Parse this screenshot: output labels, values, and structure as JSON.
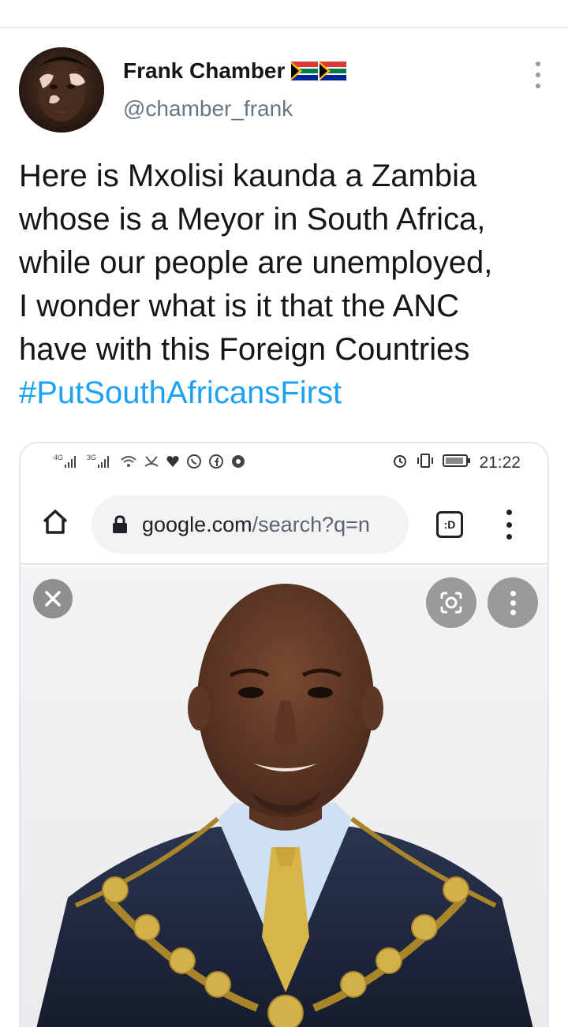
{
  "tweet": {
    "display_name": "Frank Chamber",
    "handle": "@chamber_frank",
    "flags": [
      "south-africa-flag",
      "south-africa-flag"
    ],
    "text_lines": [
      "Here is Mxolisi kaunda a Zambia",
      "whose is a Meyor in South Africa,",
      "while our people are unemployed,",
      "I wonder what is it that the ANC",
      "have with this Foreign Countries"
    ],
    "hashtag": "#PutSouthAfricansFirst"
  },
  "screenshot": {
    "status_bar": {
      "network_1": "4G",
      "network_2": "3G",
      "time": "21:22",
      "icons": [
        "signal-icon",
        "signal-icon",
        "wifi-icon",
        "missed-call-icon",
        "heart-icon",
        "whatsapp-icon",
        "facebook-icon",
        "browser-icon",
        "alarm-icon",
        "vibrate-icon",
        "battery-icon"
      ]
    },
    "browser": {
      "url_host": "google.com",
      "url_rest": "/search?q=n",
      "tabs_label": ":D"
    }
  },
  "colors": {
    "hashtag": "#1da1f2",
    "handle": "#657786",
    "url_pill": "#f1f3f4",
    "overlay_button": "#9a9a9a"
  }
}
